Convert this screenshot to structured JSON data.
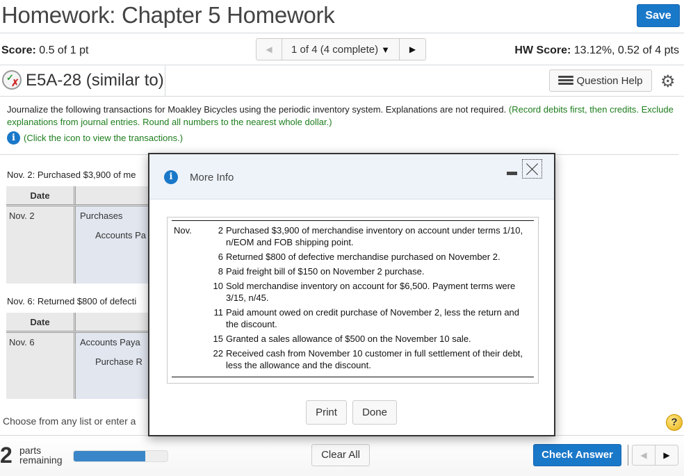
{
  "header": {
    "title": "Homework: Chapter 5 Homework",
    "save_label": "Save"
  },
  "score_bar": {
    "score_label": "Score:",
    "score_value": " 0.5 of 1 pt",
    "pager_label": "1 of 4 (4 complete)",
    "hw_score_label": "HW Score:",
    "hw_score_value": " 13.12%, 0.52 of 4 pts"
  },
  "question": {
    "id_label": "E5A-28 (similar to)",
    "status": "partially-correct",
    "help_label": "Question Help"
  },
  "instructions": {
    "main": "Journalize the following transactions for Moakley Bicycles using the periodic inventory system. Explanations are not required. ",
    "note": "(Record debits first, then credits. Exclude explanations from journal entries. Round all numbers to the nearest whole dollar.)",
    "click_hint": "(Click the icon to view the transactions.)"
  },
  "journal_entries": [
    {
      "label": "Nov. 2: Purchased $3,900 of me",
      "date_header": "Date",
      "date": "Nov. 2",
      "accounts": [
        {
          "name": "Purchases",
          "indent": false
        },
        {
          "name": "Accounts Pa",
          "indent": true
        }
      ]
    },
    {
      "label": "Nov. 6: Returned $800 of defecti",
      "date_header": "Date",
      "date": "Nov. 6",
      "accounts": [
        {
          "name": "Accounts Paya",
          "indent": false
        },
        {
          "name": "Purchase R",
          "indent": true
        }
      ]
    }
  ],
  "choose_text": "Choose from any list or enter a",
  "modal": {
    "title": "More Info",
    "month": "Nov.",
    "transactions": [
      {
        "day": "2",
        "text": "Purchased $3,900 of merchandise inventory on account under terms 1/10, n/EOM and FOB shipping point."
      },
      {
        "day": "6",
        "text": "Returned $800 of defective merchandise purchased on November 2."
      },
      {
        "day": "8",
        "text": "Paid freight bill of $150 on November 2 purchase."
      },
      {
        "day": "10",
        "text": "Sold merchandise inventory on account for $6,500. Payment terms were 3/15, n/45."
      },
      {
        "day": "11",
        "text": "Paid amount owed on credit purchase of November 2, less the return and the discount."
      },
      {
        "day": "15",
        "text": "Granted a sales allowance of $500 on the November 10 sale."
      },
      {
        "day": "22",
        "text": "Received cash from November 10 customer in full settlement of their debt, less the allowance and the discount."
      }
    ],
    "print_label": "Print",
    "done_label": "Done"
  },
  "footer": {
    "parts_count": "2",
    "parts_label_1": "parts",
    "parts_label_2": "remaining",
    "progress_percent": 76,
    "clear_all_label": "Clear All",
    "check_answer_label": "Check Answer",
    "help_symbol": "?"
  },
  "colors": {
    "primary_blue": "#1a78c9",
    "instruction_green": "#1d7d1d",
    "table_gray": "#e9e9e9",
    "account_cell_blue": "#e1e6ef"
  }
}
